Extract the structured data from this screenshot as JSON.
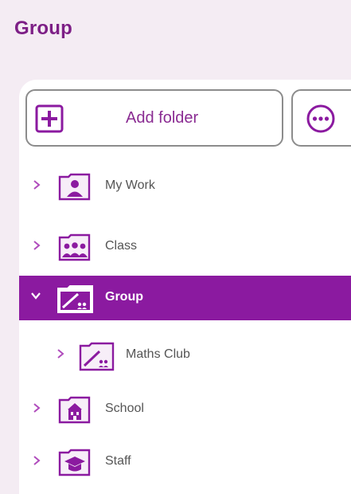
{
  "page": {
    "title": "Group"
  },
  "toolbar": {
    "add_folder_label": "Add folder",
    "add_icon": "plus-box-icon",
    "more_icon": "ellipsis-circle-icon"
  },
  "tree": {
    "items": [
      {
        "label": "My Work",
        "icon": "person-folder-icon",
        "expanded": false,
        "selected": false,
        "level": 0
      },
      {
        "label": "Class",
        "icon": "people-folder-icon",
        "expanded": false,
        "selected": false,
        "level": 0
      },
      {
        "label": "Group",
        "icon": "group-folder-icon",
        "expanded": true,
        "selected": true,
        "level": 0
      },
      {
        "label": "Maths Club",
        "icon": "group-folder-icon",
        "expanded": false,
        "selected": false,
        "level": 1
      },
      {
        "label": "School",
        "icon": "school-folder-icon",
        "expanded": false,
        "selected": false,
        "level": 0
      },
      {
        "label": "Staff",
        "icon": "graduation-cap-folder-icon",
        "expanded": false,
        "selected": false,
        "level": 0
      }
    ]
  },
  "colors": {
    "accent": "#8b1aa0",
    "title": "#7d1f86",
    "background": "#f4ecf3"
  }
}
